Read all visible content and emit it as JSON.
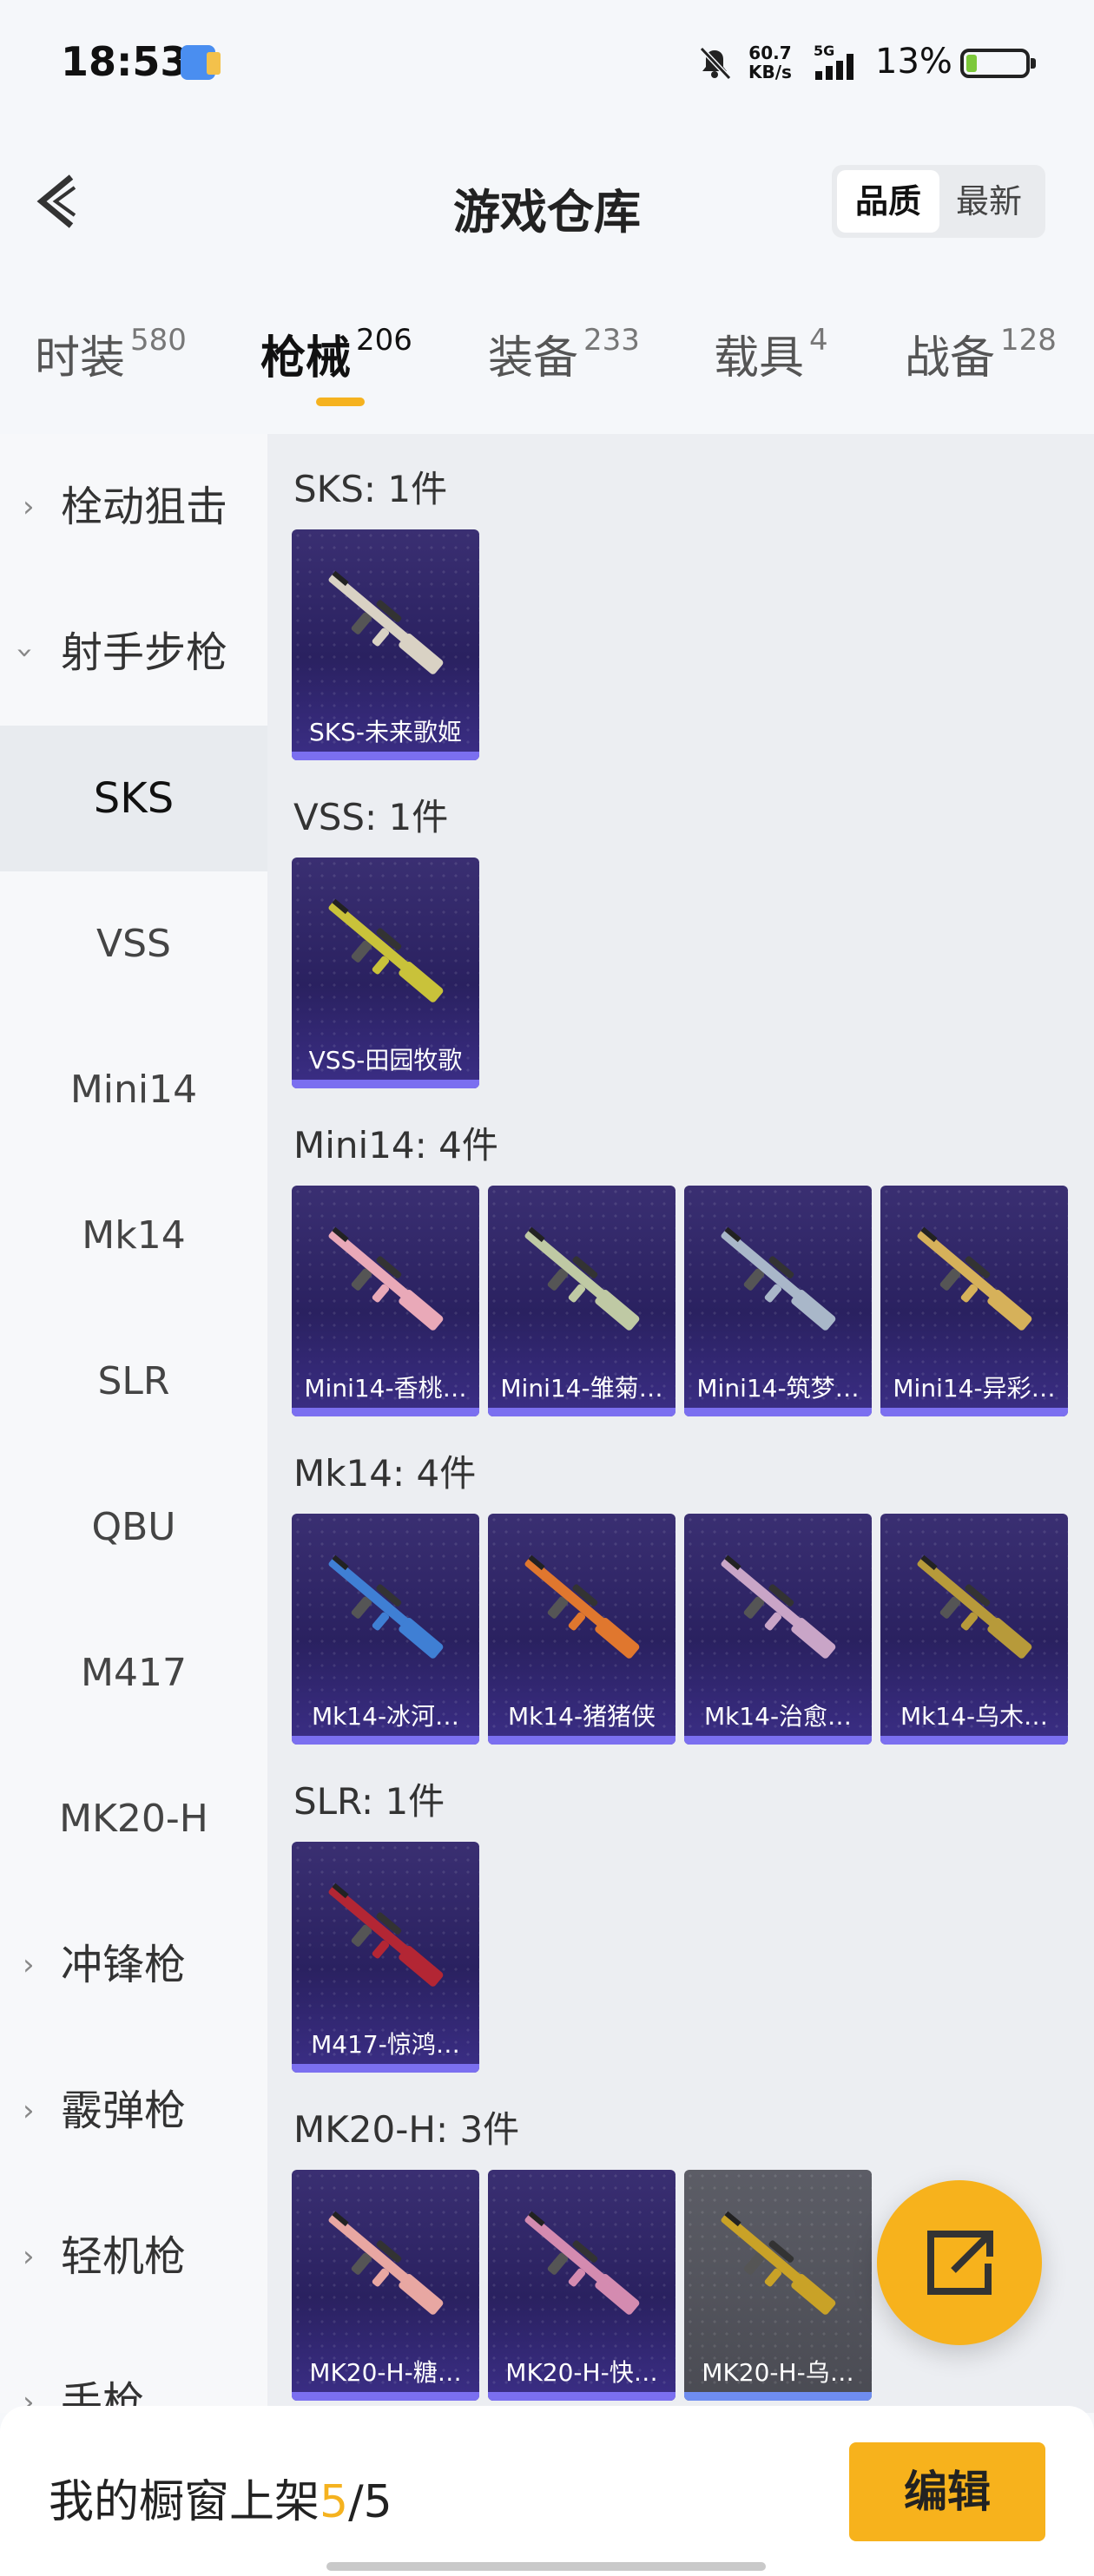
{
  "status_bar": {
    "time": "18:53",
    "net_speed_value": "60.7",
    "net_speed_unit": "KB/s",
    "network": "5G",
    "battery_percent": "13%",
    "battery_level": 0.13
  },
  "header": {
    "title": "游戏仓库",
    "sort_options": [
      "品质",
      "最新"
    ],
    "sort_selected": "品质"
  },
  "category_tabs": [
    {
      "label": "时装",
      "count": "580"
    },
    {
      "label": "枪械",
      "count": "206",
      "active": true
    },
    {
      "label": "装备",
      "count": "233"
    },
    {
      "label": "载具",
      "count": "4"
    },
    {
      "label": "战备",
      "count": "128"
    }
  ],
  "sidebar": {
    "items": [
      {
        "label": "栓动狙击",
        "type": "group",
        "expanded": false
      },
      {
        "label": "射手步枪",
        "type": "group",
        "expanded": true
      },
      {
        "label": "SKS",
        "type": "sub",
        "selected": true
      },
      {
        "label": "VSS",
        "type": "sub"
      },
      {
        "label": "Mini14",
        "type": "sub"
      },
      {
        "label": "Mk14",
        "type": "sub"
      },
      {
        "label": "SLR",
        "type": "sub"
      },
      {
        "label": "QBU",
        "type": "sub"
      },
      {
        "label": "M417",
        "type": "sub"
      },
      {
        "label": "MK20-H",
        "type": "sub"
      },
      {
        "label": "冲锋枪",
        "type": "group",
        "expanded": false
      },
      {
        "label": "霰弹枪",
        "type": "group",
        "expanded": false
      },
      {
        "label": "轻机枪",
        "type": "group",
        "expanded": false
      },
      {
        "label": "手枪",
        "type": "group",
        "expanded": false
      }
    ]
  },
  "sections": [
    {
      "title": "SKS: 1件",
      "items": [
        {
          "name": "SKS-未来歌姬",
          "color": "#d9d2c4"
        }
      ]
    },
    {
      "title": "VSS: 1件",
      "items": [
        {
          "name": "VSS-田园牧歌",
          "color": "#c9c23a"
        }
      ]
    },
    {
      "title": "Mini14: 4件",
      "items": [
        {
          "name": "Mini14-香桃…",
          "color": "#e9a9b8"
        },
        {
          "name": "Mini14-雏菊…",
          "color": "#bfc9a4"
        },
        {
          "name": "Mini14-筑梦…",
          "color": "#a9b7c9"
        },
        {
          "name": "Mini14-异彩…",
          "color": "#d6b15a"
        }
      ]
    },
    {
      "title": "Mk14: 4件",
      "items": [
        {
          "name": "Mk14-冰河…",
          "color": "#3f7fd4"
        },
        {
          "name": "Mk14-猪猪侠",
          "color": "#e0772e"
        },
        {
          "name": "Mk14-治愈…",
          "color": "#c9a5c7"
        },
        {
          "name": "Mk14-乌木…",
          "color": "#b79a3a"
        }
      ]
    },
    {
      "title": "SLR: 1件",
      "items": [
        {
          "name": "M417-惊鸿…",
          "color": "#b32634"
        }
      ]
    },
    {
      "title": "MK20-H: 3件",
      "items": [
        {
          "name": "MK20-H-糖…",
          "color": "#e8a7a2"
        },
        {
          "name": "MK20-H-快…",
          "color": "#d48bb0"
        },
        {
          "name": "MK20-H-乌…",
          "color": "#c9a227",
          "gray": true
        }
      ]
    }
  ],
  "bottom_bar": {
    "showcase_label": "我的橱窗上架",
    "showcase_current": "5",
    "showcase_sep": "/",
    "showcase_total": "5",
    "edit_label": "编辑"
  },
  "colors": {
    "accent": "#f7b21c",
    "card_bg": "#2a2160",
    "card_bar": "#7b6ff0"
  }
}
